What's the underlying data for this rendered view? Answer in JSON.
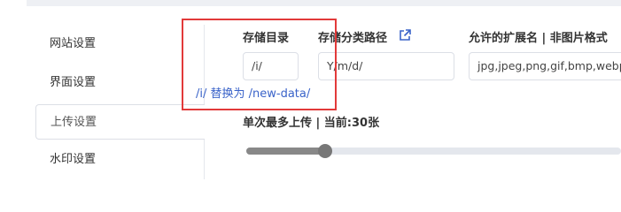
{
  "menu": {
    "items": [
      {
        "label": "网站设置"
      },
      {
        "label": "界面设置"
      },
      {
        "label": "上传设置",
        "active": true
      },
      {
        "label": "水印设置"
      }
    ]
  },
  "form": {
    "storage_dir": {
      "label": "存储目录",
      "value": "/i/"
    },
    "storage_path": {
      "label": "存储分类路径",
      "value": "Y/m/d/",
      "icon": "external-link-icon"
    },
    "allowed_ext": {
      "label": "允许的扩展名 | 非图片格式",
      "value": "jpg,jpeg,png,gif,bmp,webp"
    },
    "hint": "/i/ 替换为 /new-data/",
    "max_upload": {
      "label": "单次最多上传 | 当前:30张",
      "value": 30,
      "fraction": 0.21
    }
  },
  "colors": {
    "highlight": "#e23a3a",
    "hint": "#3a63c9"
  }
}
